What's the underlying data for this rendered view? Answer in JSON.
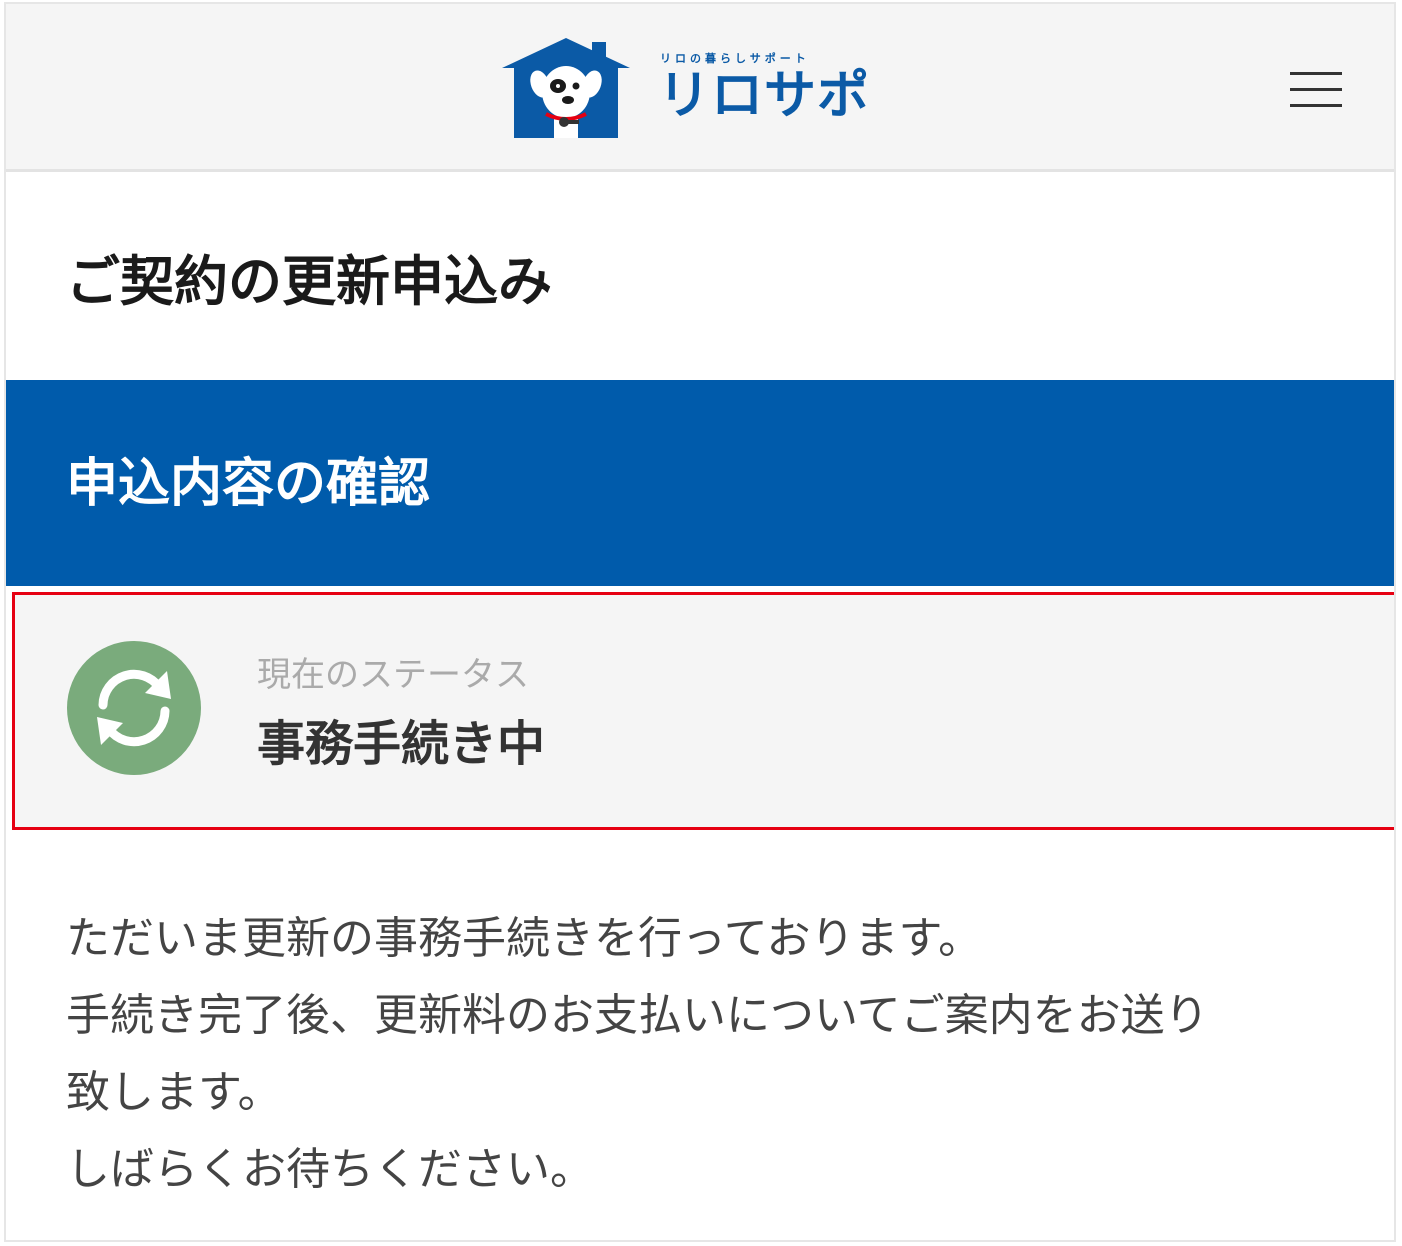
{
  "header": {
    "logo_tagline": "リロの暮らしサポート",
    "logo_text": "リロサポ",
    "menu_icon": "hamburger-menu-icon"
  },
  "page": {
    "title": "ご契約の更新申込み"
  },
  "section": {
    "title": "申込内容の確認"
  },
  "status": {
    "icon": "refresh-icon",
    "label": "現在のステータス",
    "value": "事務手続き中",
    "icon_color": "#7aab7c",
    "highlight_color": "#e60012"
  },
  "message": {
    "lines": [
      "ただいま更新の事務手続きを行っております。",
      "手続き完了後、更新料のお支払いについてご案内をお送り",
      "致します。",
      "しばらくお待ちください。"
    ]
  },
  "colors": {
    "brand_blue": "#005bab",
    "logo_blue": "#0b5aa6",
    "header_bg": "#f5f5f5"
  }
}
